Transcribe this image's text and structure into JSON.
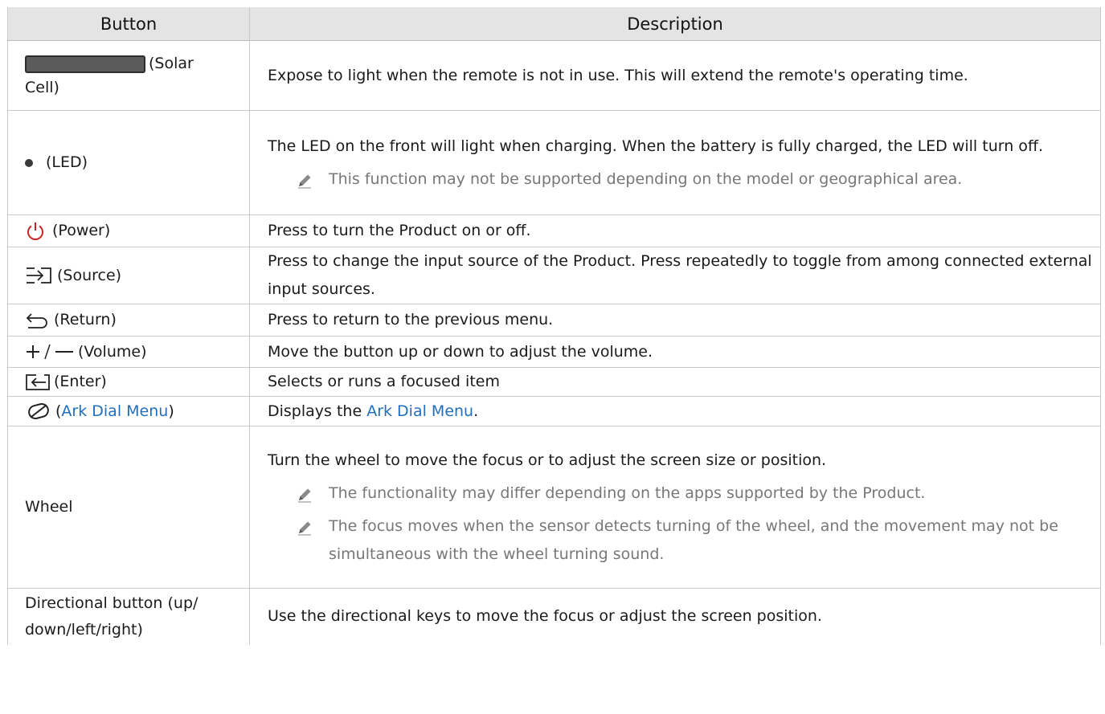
{
  "header": {
    "col_button": "Button",
    "col_description": "Description"
  },
  "rows": [
    {
      "button_icon": "solar-cell-icon",
      "button_label": "(Solar",
      "button_label2": "Cell)",
      "description": "Expose to light when the remote is not in use. This will extend the remote's operating time."
    },
    {
      "button_icon": "led-dot-icon",
      "button_label": "(LED)",
      "description": "The LED on the front will light when charging. When the battery is fully charged, the LED will turn off.",
      "notes": [
        "This function may not be supported depending on the model or geographical area."
      ]
    },
    {
      "button_icon": "power-icon",
      "button_label": "(Power)",
      "description": "Press to turn the Product on or off."
    },
    {
      "button_icon": "source-icon",
      "button_label": "(Source)",
      "description": "Press to change the input source of the Product. Press repeatedly to toggle from among connected external input sources."
    },
    {
      "button_icon": "return-icon",
      "button_label": "(Return)",
      "description": "Press to return to the previous menu."
    },
    {
      "button_icon": "volume-plus-minus-icon",
      "button_label": "(Volume)",
      "description": "Move the button up or down to adjust the volume."
    },
    {
      "button_icon": "enter-icon",
      "button_label": "(Enter)",
      "description": "Selects or runs a focused item"
    },
    {
      "button_icon": "ark-dial-icon",
      "button_label_prefix": "(",
      "button_label_link": "Ark Dial Menu",
      "button_label_suffix": ")",
      "description_prefix": "Displays the ",
      "description_link": "Ark Dial Menu",
      "description_suffix": "."
    },
    {
      "button_label": "Wheel",
      "description": "Turn the wheel to move the focus or to adjust the screen size or position.",
      "notes": [
        "The functionality may differ depending on the apps supported by the Product.",
        "The focus moves when the sensor detects turning of the wheel, and the movement may not be simultaneous with the wheel turning sound."
      ]
    },
    {
      "button_label": "Directional button (up/ down/left/right)",
      "description": "Use the directional keys to move the focus or adjust the screen position."
    }
  ],
  "colors": {
    "header_bg": "#e4e4e4",
    "border": "#c9c9c9",
    "link": "#1f6fbf",
    "power_icon": "#c62828",
    "note_text": "#777777"
  }
}
